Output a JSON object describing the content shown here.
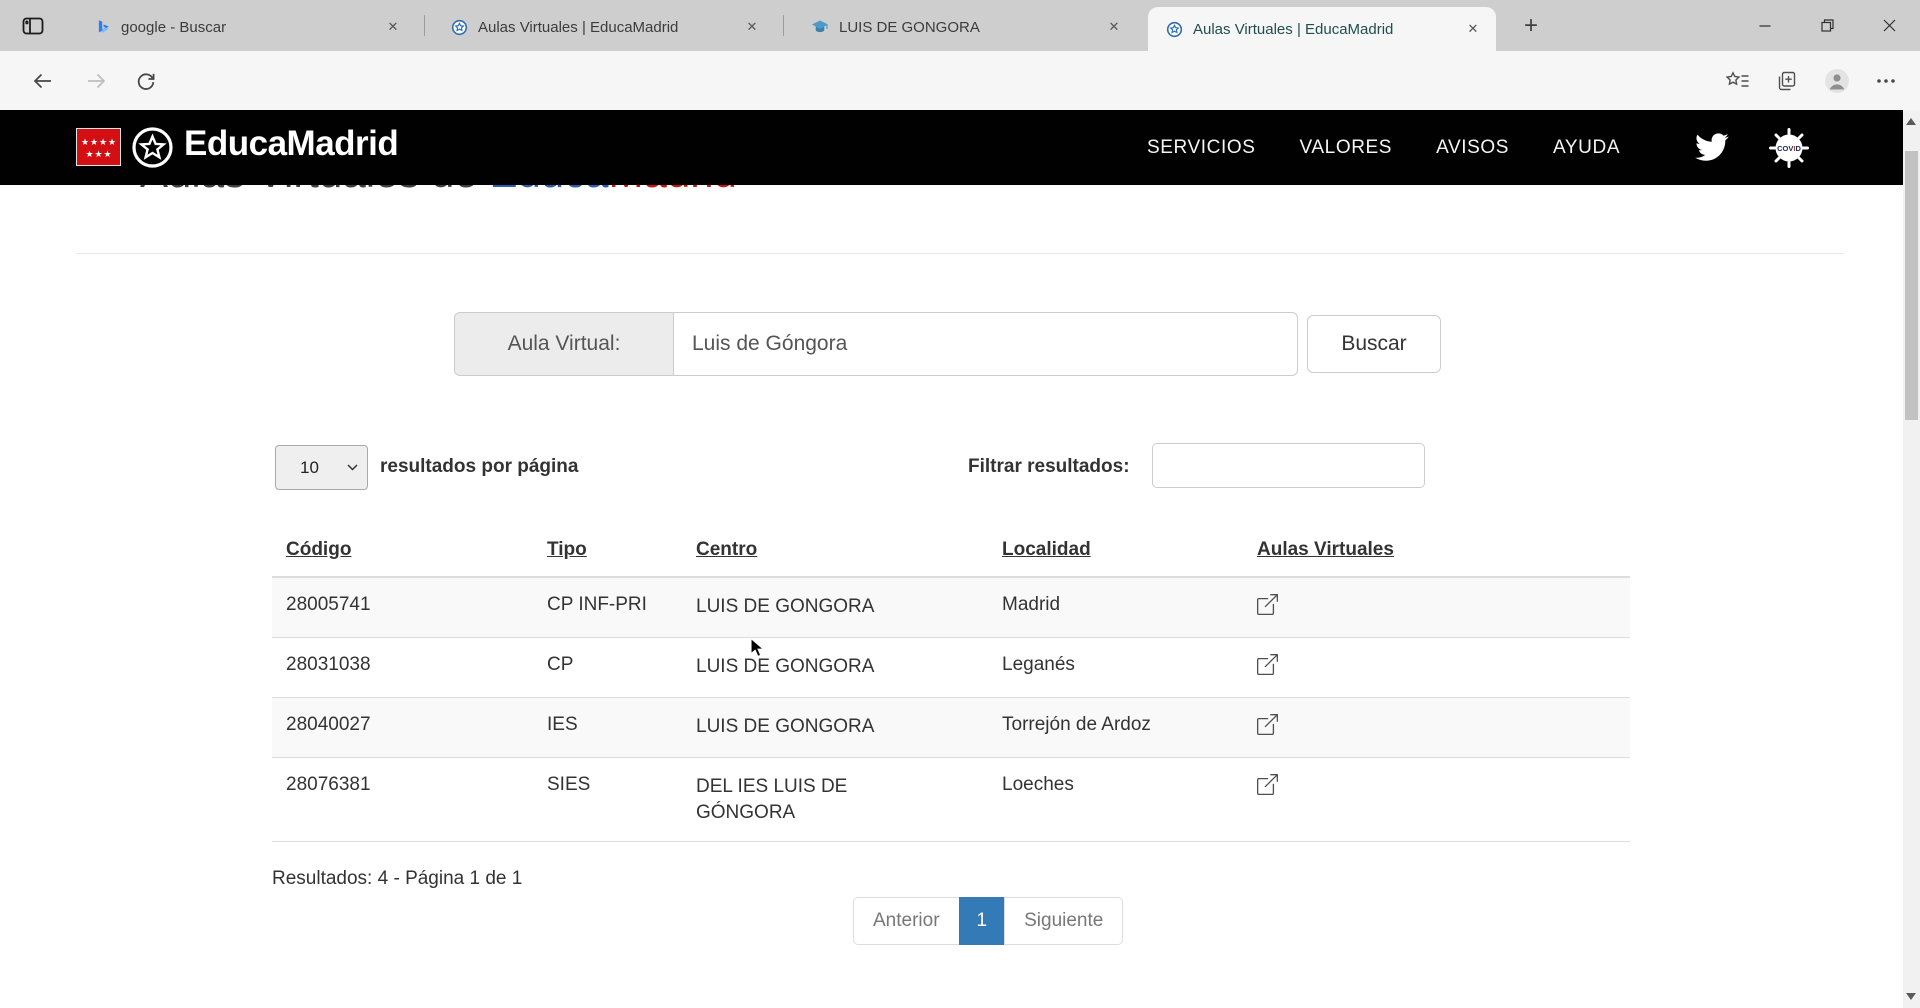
{
  "browser": {
    "tabs": [
      {
        "title": "google - Buscar",
        "icon": "bing-icon"
      },
      {
        "title": "Aulas Virtuales | EducaMadrid",
        "icon": "educamadrid-icon"
      },
      {
        "title": "LUIS DE GONGORA",
        "icon": "graduation-cap-icon"
      },
      {
        "title": "Aulas Virtuales | EducaMadrid",
        "icon": "educamadrid-icon",
        "active": true
      }
    ],
    "url": "https://www.educa2.madrid.org/educamadrid/aula-virtual"
  },
  "site_header": {
    "brand": "EducaMadrid",
    "nav": [
      "SERVICIOS",
      "VALORES",
      "AVISOS",
      "AYUDA"
    ],
    "covid_badge": "COVID"
  },
  "page": {
    "title_parts": {
      "prefix": "Aulas Virtuales de ",
      "educa": "Educa",
      "madrid": "Madrid"
    },
    "search": {
      "label": "Aula Virtual:",
      "value": "Luis de Góngora",
      "button_label": "Buscar"
    },
    "per_page": {
      "selected": "10",
      "suffix_label": "resultados por página"
    },
    "filter": {
      "label": "Filtrar resultados:",
      "value": ""
    },
    "table": {
      "headers": [
        "Código",
        "Tipo",
        "Centro",
        "Localidad",
        "Aulas Virtuales"
      ],
      "rows": [
        {
          "codigo": "28005741",
          "tipo": "CP INF-PRI",
          "centro": "LUIS DE GONGORA",
          "localidad": "Madrid"
        },
        {
          "codigo": "28031038",
          "tipo": "CP",
          "centro": "LUIS DE GONGORA",
          "localidad": "Leganés"
        },
        {
          "codigo": "28040027",
          "tipo": "IES",
          "centro": "LUIS DE GONGORA",
          "localidad": "Torrejón de Ardoz"
        },
        {
          "codigo": "28076381",
          "tipo": "SIES",
          "centro": "DEL IES LUIS DE GÓNGORA",
          "localidad": "Loeches"
        }
      ]
    },
    "results_summary": "Resultados: 4 - Página 1 de 1",
    "pagination": {
      "previous": "Anterior",
      "current": "1",
      "next": "Siguiente"
    }
  },
  "colors": {
    "accent_blue": "#337ab7",
    "brand_red": "#cc1111",
    "brand_blue": "#2a5db0",
    "header_bg": "#010101"
  }
}
